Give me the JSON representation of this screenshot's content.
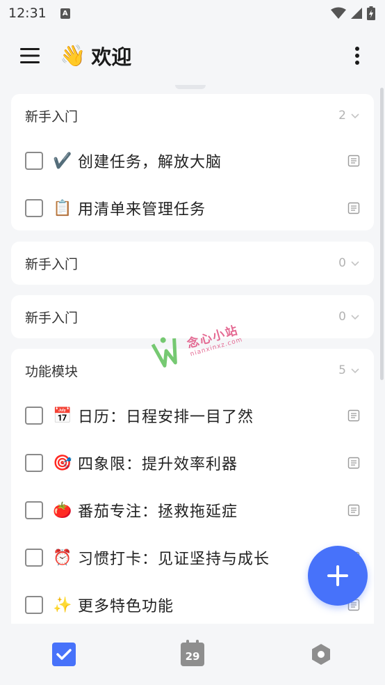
{
  "status_bar": {
    "time": "12:31",
    "notification_badge": "A",
    "icons": [
      "wifi-icon",
      "signal-icon",
      "battery-charging-icon"
    ]
  },
  "app_bar": {
    "title_emoji": "👋",
    "title": "欢迎",
    "menu_icon": "menu-icon",
    "more_icon": "more-vertical-icon"
  },
  "sections": [
    {
      "title": "新手入门",
      "count": "2",
      "tasks": [
        {
          "emoji": "✔️",
          "text": "创建任务，解放大脑"
        },
        {
          "emoji": "📋",
          "text": "用清单来管理任务"
        }
      ]
    },
    {
      "title": "新手入门",
      "count": "0",
      "tasks": []
    },
    {
      "title": "新手入门",
      "count": "0",
      "tasks": []
    },
    {
      "title": "功能模块",
      "count": "5",
      "tasks": [
        {
          "emoji": "📅",
          "text": "日历：日程安排一目了然"
        },
        {
          "emoji": "🎯",
          "text": "四象限：提升效率利器"
        },
        {
          "emoji": "🍅",
          "text": "番茄专注：拯救拖延症"
        },
        {
          "emoji": "⏰",
          "text": "习惯打卡：见证坚持与成长"
        },
        {
          "emoji": "✨",
          "text": "更多特色功能"
        }
      ]
    }
  ],
  "watermark": {
    "name": "念心小站",
    "url": "nianxinxz.com"
  },
  "fab": {
    "icon": "plus-icon",
    "color": "#4772fa"
  },
  "bottom_nav": {
    "tasks_icon": "checkbox-checked-icon",
    "calendar_day": "29",
    "settings_icon": "settings-hexagon-icon",
    "accent": "#4772fa"
  }
}
